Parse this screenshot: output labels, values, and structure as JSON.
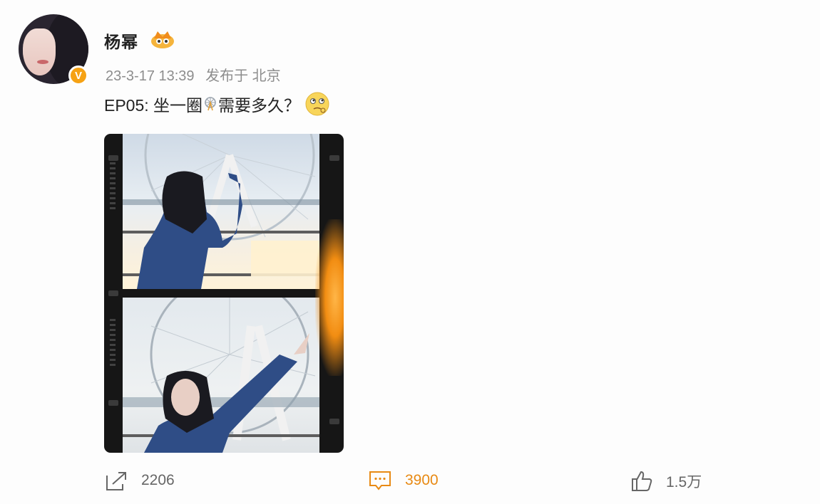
{
  "author": {
    "name": "杨幂",
    "avatar_icon": "avatar",
    "verified_icon": "verified-v-icon",
    "verified_mark": "V",
    "member_icon": "crown-badge-icon"
  },
  "post": {
    "date": "23-3-17 13:39",
    "location_label": "发布于 北京",
    "text_before": "EP05: 坐一圈",
    "text_after": "需要多久？",
    "inline_icon": "ferris-wheel-emoji",
    "trailing_icon": "thinking-face-emoji",
    "image_icon": "film-strip-photo"
  },
  "actions": {
    "repost_count": "2206",
    "comment_count": "3900",
    "like_count": "1.5万"
  },
  "colors": {
    "accent": "#e88a14",
    "badge": "#f6a214",
    "meta": "#8d8d8d"
  }
}
